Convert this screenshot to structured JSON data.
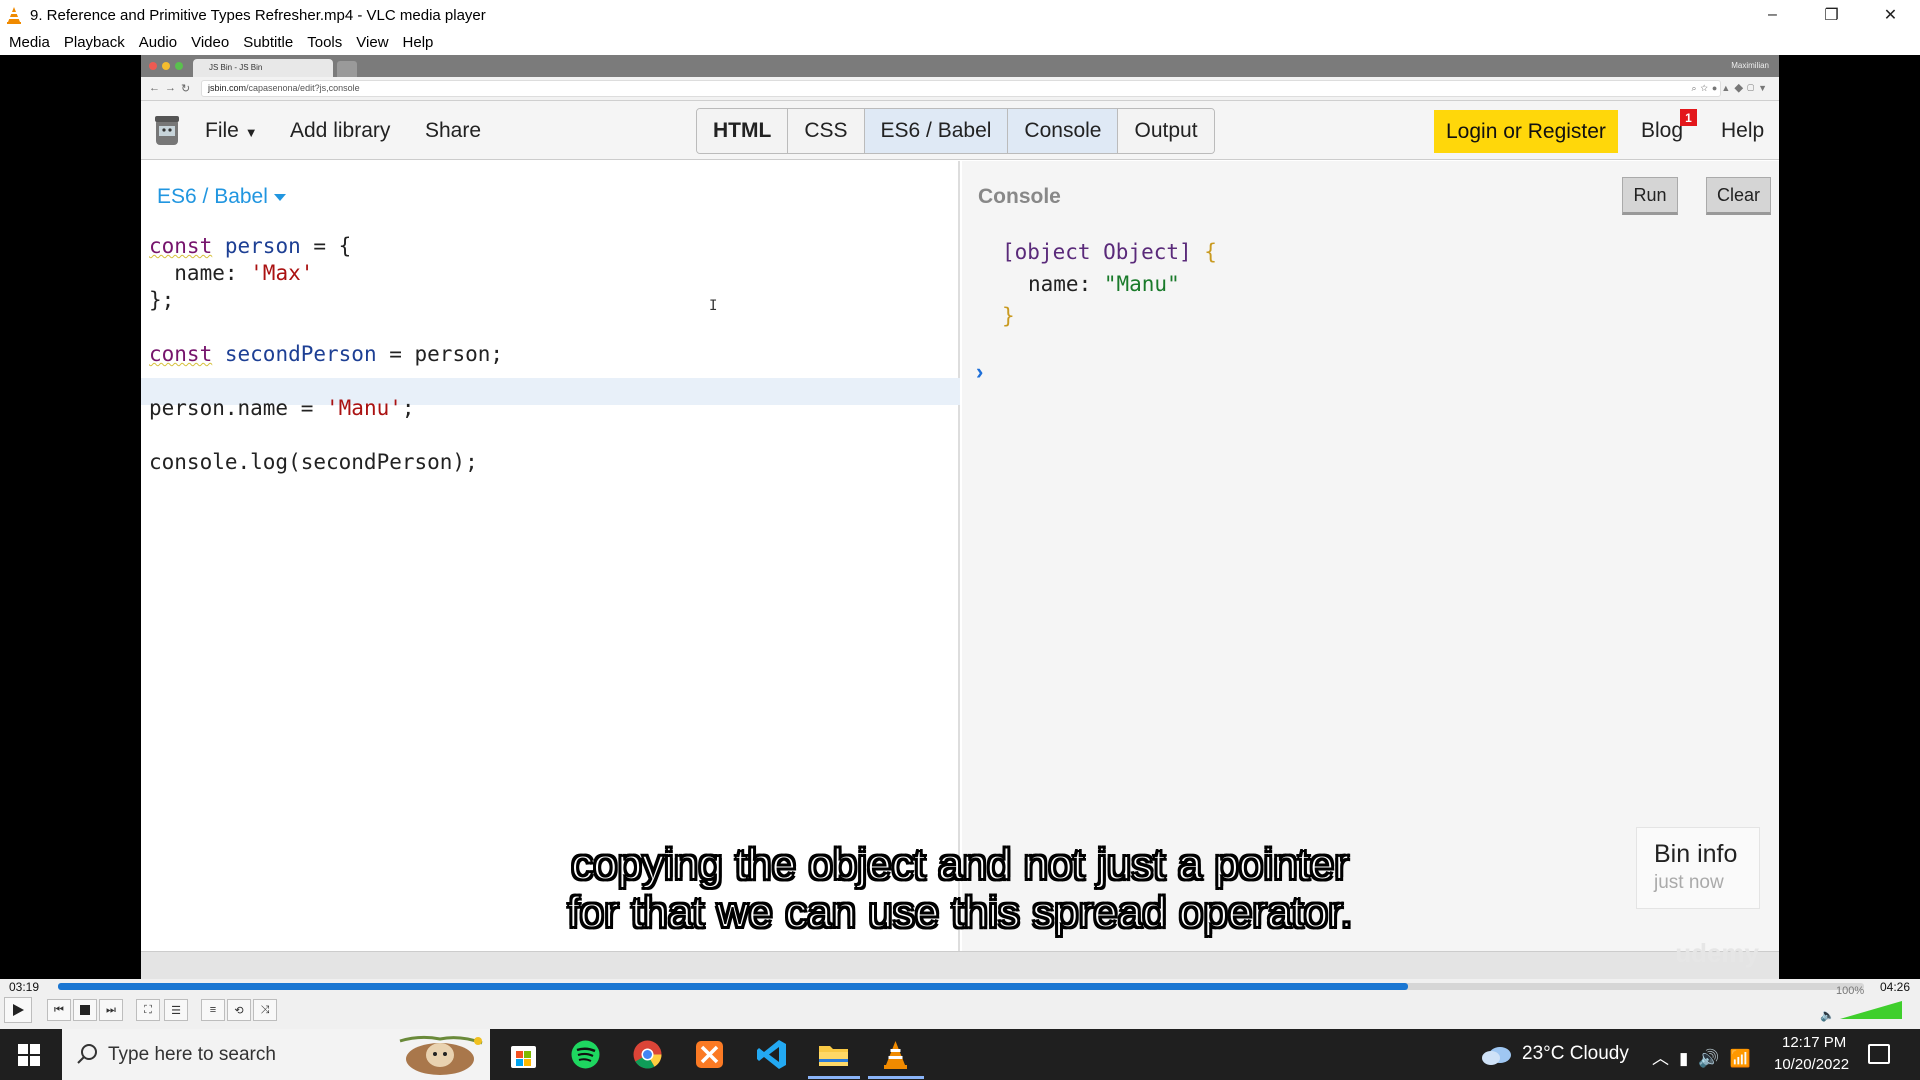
{
  "window": {
    "title": "9. Reference and Primitive Types Refresher.mp4 - VLC media player",
    "controls": [
      "–",
      "❐",
      "✕"
    ]
  },
  "menu": [
    "Media",
    "Playback",
    "Audio",
    "Video",
    "Subtitle",
    "Tools",
    "View",
    "Help"
  ],
  "browser": {
    "tab_label": "JS Bin - JS Bin",
    "url_host": "jsbin.com",
    "url_path": "/capasenona/edit?js,console",
    "profile": "Maximilian"
  },
  "jsbin": {
    "file_label": "File",
    "add_library": "Add library",
    "share": "Share",
    "panels": [
      {
        "label": "HTML",
        "active": false,
        "bold": true
      },
      {
        "label": "CSS",
        "active": false,
        "bold": false
      },
      {
        "label": "ES6 / Babel",
        "active": true,
        "bold": false
      },
      {
        "label": "Console",
        "active": true,
        "bold": false
      },
      {
        "label": "Output",
        "active": false,
        "bold": false
      }
    ],
    "login": "Login or Register",
    "blog": "Blog",
    "blog_badge": "1",
    "help": "Help"
  },
  "editor": {
    "language": "ES6 / Babel",
    "code": {
      "l1_kw": "const",
      "l1_var": "person",
      "l1_rest": " = {",
      "l2_key": "  name: ",
      "l2_str": "'Max'",
      "l3": "};",
      "l4_kw": "const",
      "l4_var": "secondPerson",
      "l4_rest": " = person;",
      "l5_pre": "person.name = ",
      "l5_str": "'Manu'",
      "l5_post": ";",
      "l6": "console.log(secondPerson);"
    }
  },
  "console": {
    "label": "Console",
    "run": "Run",
    "clear": "Clear",
    "out_obj": "[object Object]",
    "out_open": " {",
    "out_key": "name: ",
    "out_val": "\"Manu\"",
    "out_close": "}",
    "prompt": "›"
  },
  "bin_info": {
    "title": "Bin info",
    "subtitle": "just now"
  },
  "watermark": "udemy",
  "subtitle": {
    "line1": "copying the object and not just a pointer",
    "line2": "for that we can use this spread operator."
  },
  "player": {
    "elapsed": "03:19",
    "total": "04:26",
    "progress": 0.7476,
    "volume_label": "100%",
    "volume": 1.0
  },
  "taskbar": {
    "search_placeholder": "Type here to search",
    "weather": "23°C  Cloudy",
    "time": "12:17 PM",
    "date": "10/20/2022"
  },
  "colors": {
    "login_bg": "#ffd70a",
    "accent_blue": "#2196e0",
    "seek_fill": "#1a76d2",
    "badge_red": "#e3171b"
  }
}
